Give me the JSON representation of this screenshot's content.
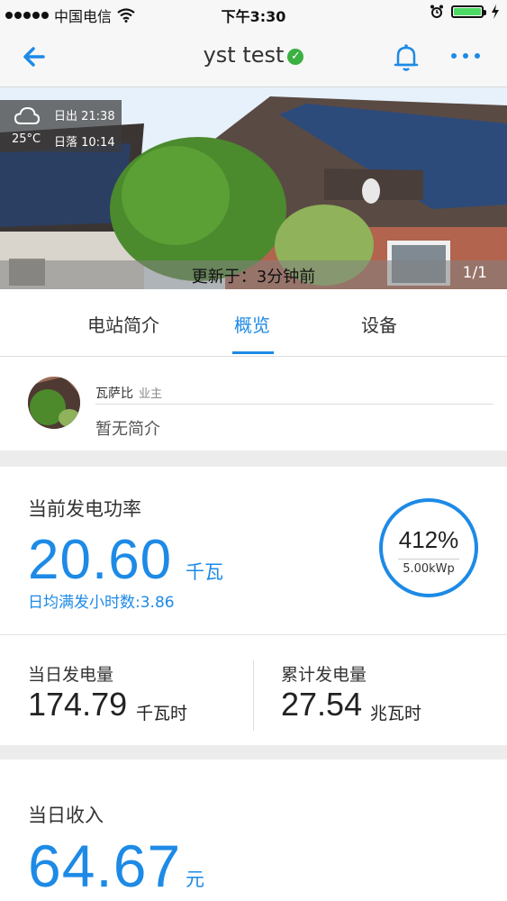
{
  "status_bar": {
    "carrier": "中国电信",
    "time": "下午3:30"
  },
  "header": {
    "title": "yst test"
  },
  "hero": {
    "weather": {
      "temperature": "25°C",
      "sunrise": "日出 21:38",
      "sunset": "日落 10:14"
    },
    "update_text": "更新于：3分钟前",
    "page_indicator": "1/1"
  },
  "tabs": [
    {
      "label": "电站简介"
    },
    {
      "label": "概览"
    },
    {
      "label": "设备"
    }
  ],
  "active_tab": "概览",
  "owner": {
    "name": "瓦萨比",
    "role": "业主",
    "description": "暂无简介"
  },
  "power": {
    "label": "当前发电功率",
    "value": "20.60",
    "unit": "千瓦",
    "full_load_hours": "日均满发小时数:3.86",
    "ratio": "412%",
    "capacity": "5.00kWp"
  },
  "daily_energy": {
    "label": "当日发电量",
    "value": "174.79",
    "unit": "千瓦时"
  },
  "total_energy": {
    "label": "累计发电量",
    "value": "27.54",
    "unit": "兆瓦时"
  },
  "income": {
    "label": "当日收入",
    "value": "64.67",
    "unit": "元"
  },
  "colors": {
    "accent": "#1d8ae6",
    "verified": "#3cb043",
    "battery": "#4cd964"
  }
}
